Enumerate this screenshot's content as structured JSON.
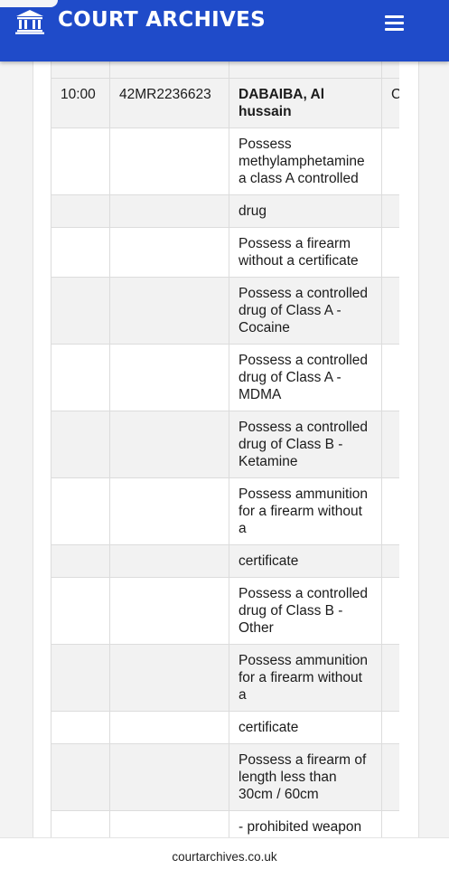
{
  "header": {
    "title": "COURT ARCHIVES",
    "logo_icon": "courthouse-icon",
    "menu_icon": "hamburger-menu-icon",
    "background_color": "#1f4bc9",
    "text_color": "#ffffff"
  },
  "table": {
    "rows": [
      {
        "time": "",
        "case_number": "",
        "defendant": "",
        "extra": ""
      },
      {
        "time": "10:00",
        "case_number": "42MR2236623",
        "defendant": "DABAIBA, Al hussain",
        "extra": "C"
      },
      {
        "time": "",
        "case_number": "",
        "defendant": "Possess methylamphetamine a class A controlled",
        "extra": ""
      },
      {
        "time": "",
        "case_number": "",
        "defendant": "drug",
        "extra": ""
      },
      {
        "time": "",
        "case_number": "",
        "defendant": "Possess a firearm without a certificate",
        "extra": ""
      },
      {
        "time": "",
        "case_number": "",
        "defendant": "Possess a controlled drug of Class A - Cocaine",
        "extra": ""
      },
      {
        "time": "",
        "case_number": "",
        "defendant": "Possess a controlled drug of Class A - MDMA",
        "extra": ""
      },
      {
        "time": "",
        "case_number": "",
        "defendant": "Possess a controlled drug of Class B - Ketamine",
        "extra": ""
      },
      {
        "time": "",
        "case_number": "",
        "defendant": "Possess ammunition for a firearm without a",
        "extra": ""
      },
      {
        "time": "",
        "case_number": "",
        "defendant": "certificate",
        "extra": ""
      },
      {
        "time": "",
        "case_number": "",
        "defendant": "Possess a controlled drug of Class B - Other",
        "extra": ""
      },
      {
        "time": "",
        "case_number": "",
        "defendant": "Possess ammunition for a firearm without a",
        "extra": ""
      },
      {
        "time": "",
        "case_number": "",
        "defendant": "certificate",
        "extra": ""
      },
      {
        "time": "",
        "case_number": "",
        "defendant": "Possess a firearm of length less than 30cm / 60cm",
        "extra": ""
      },
      {
        "time": "",
        "case_number": "",
        "defendant": "- prohibited weapon",
        "extra": ""
      },
      {
        "time": "",
        "case_number": "",
        "defendant": "",
        "extra": ""
      }
    ]
  },
  "footer": {
    "url": "courtarchives.co.uk"
  }
}
